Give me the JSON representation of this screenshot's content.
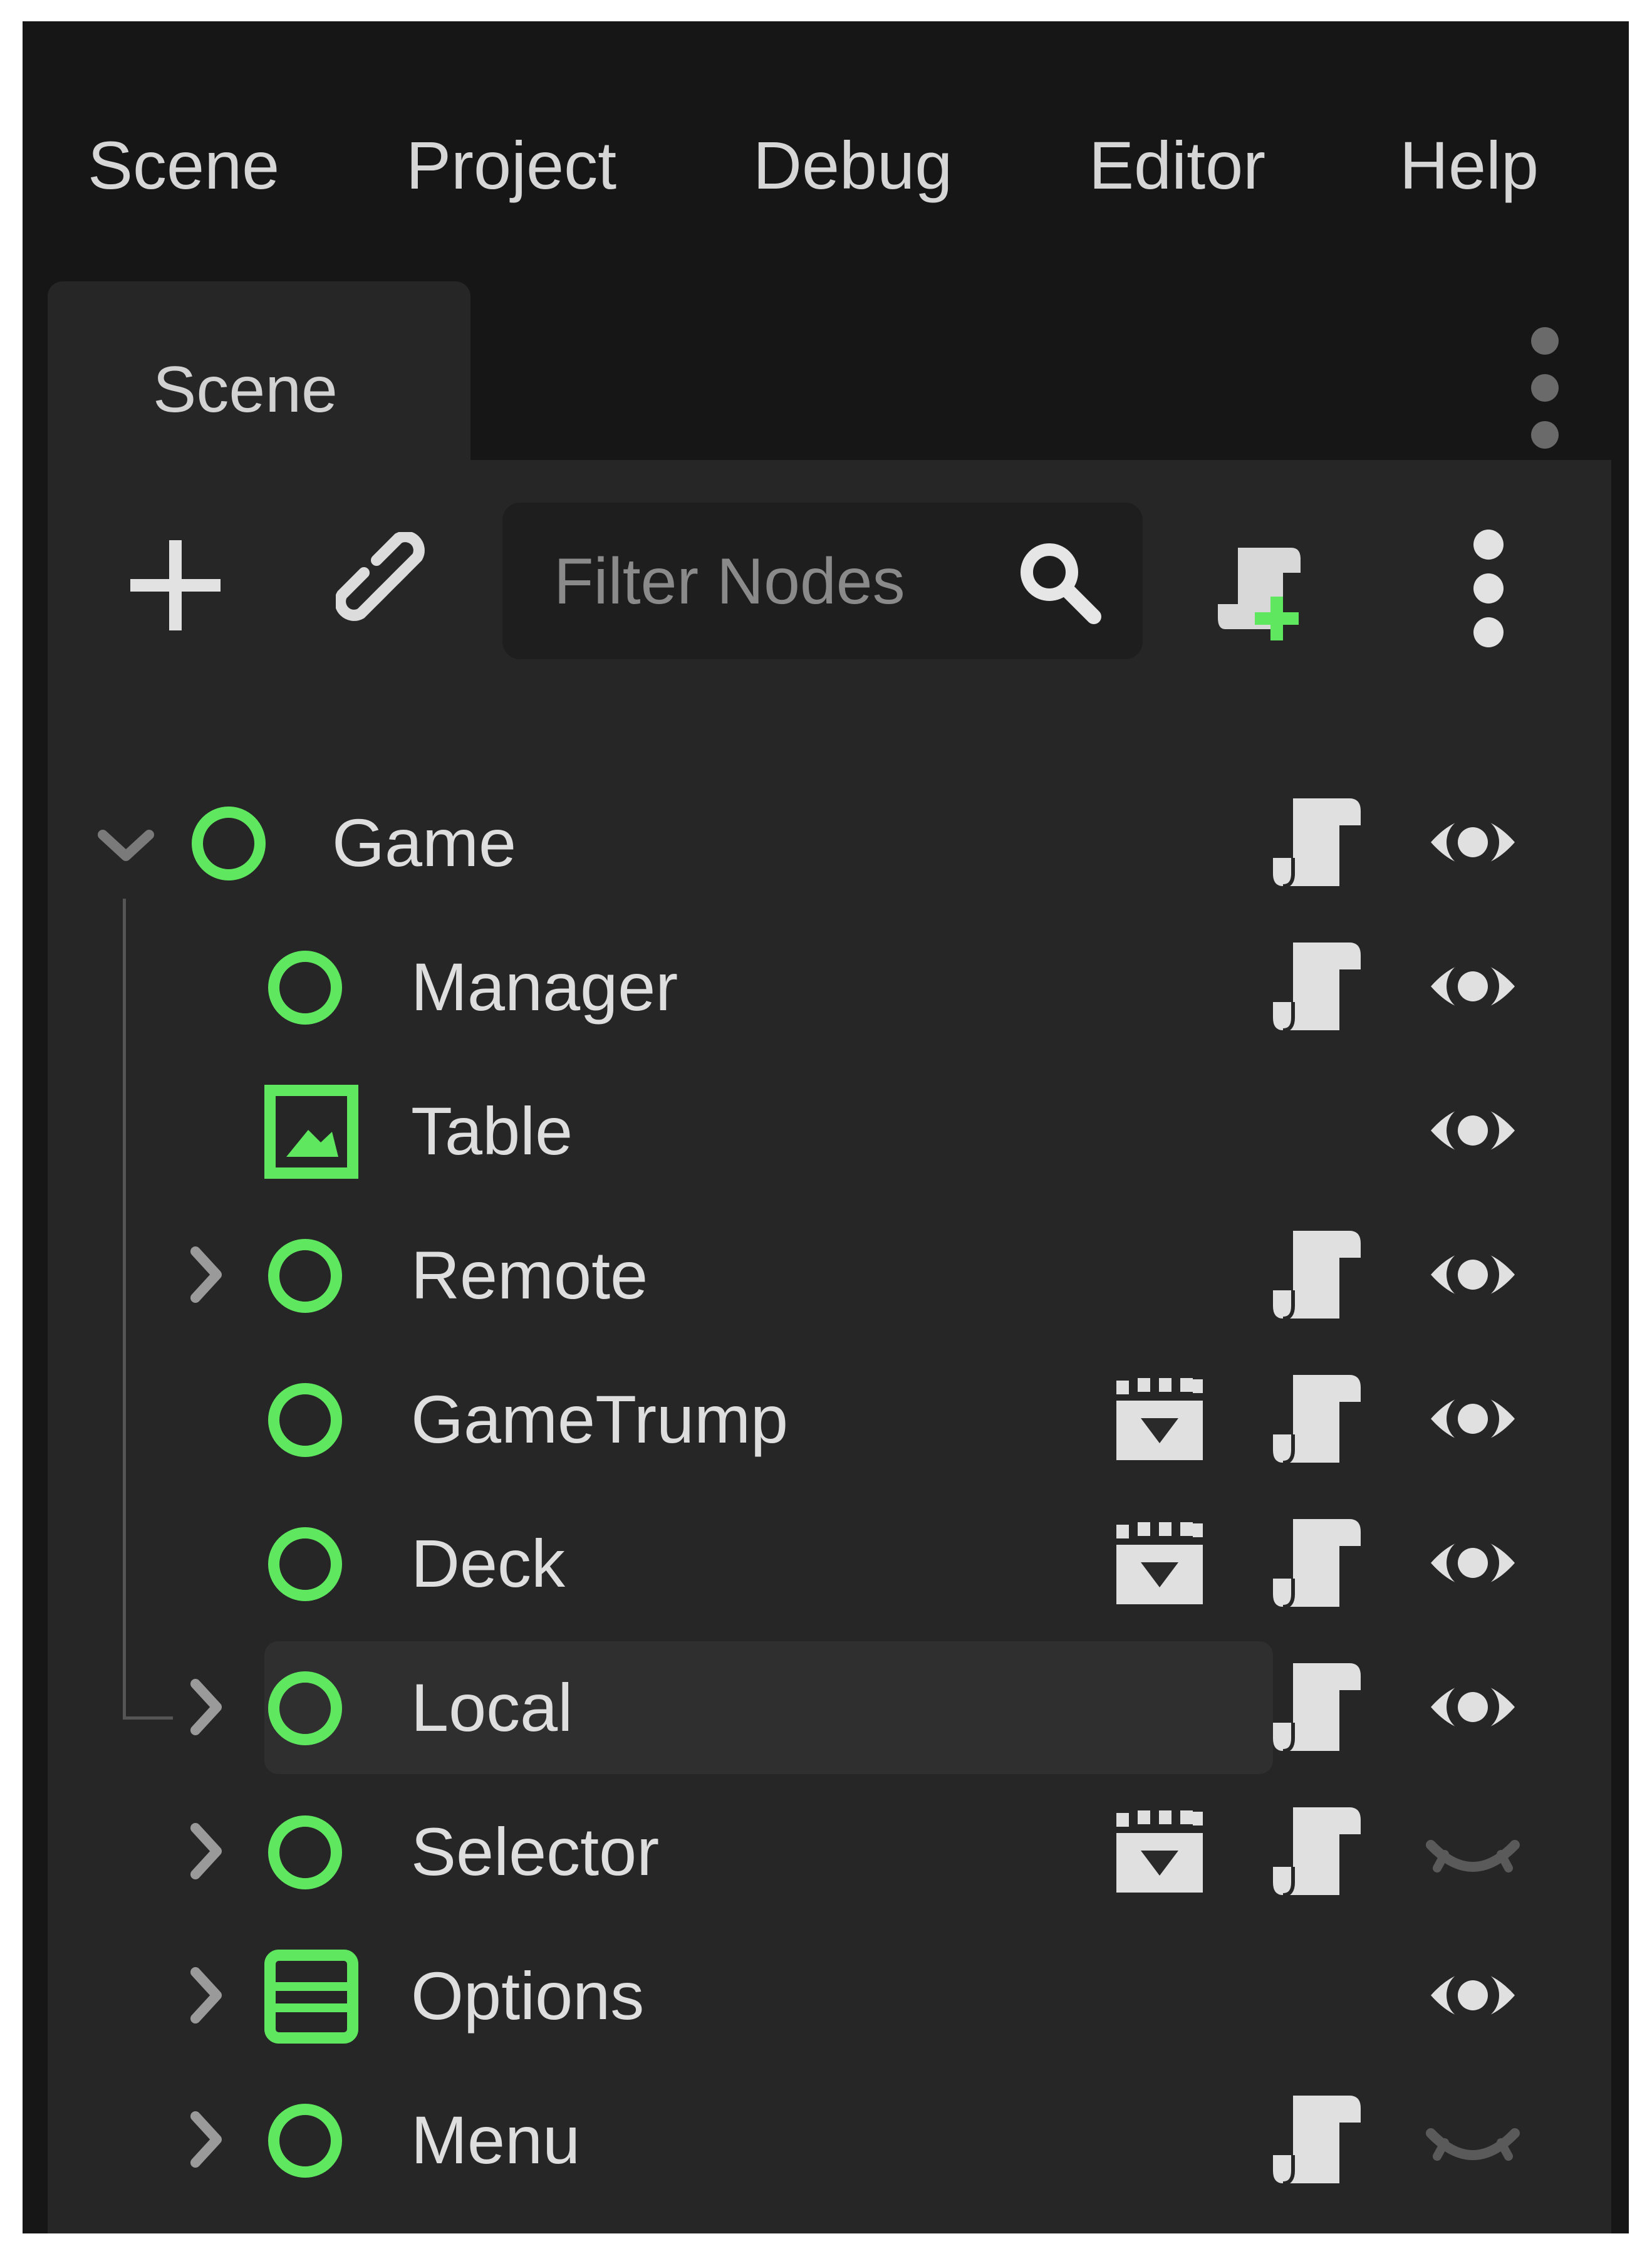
{
  "menubar": {
    "items": [
      "Scene",
      "Project",
      "Debug",
      "Editor",
      "Help"
    ]
  },
  "dock": {
    "tab_label": "Scene"
  },
  "toolbar": {
    "add_icon": "plus-icon",
    "instance_icon": "link-icon",
    "filter_placeholder": "Filter Nodes",
    "filter_icon": "search-icon",
    "attach_script_icon": "script-add-icon",
    "more_icon": "vertical-dots-icon"
  },
  "tree": {
    "nodes": [
      {
        "name": "Game",
        "depth": 0,
        "type_icon": "node-circle-icon",
        "arrow": "expanded",
        "scene_icon": false,
        "script_icon": true,
        "visible": true
      },
      {
        "name": "Manager",
        "depth": 1,
        "type_icon": "node-circle-icon",
        "arrow": "none",
        "scene_icon": false,
        "script_icon": true,
        "visible": true
      },
      {
        "name": "Table",
        "depth": 1,
        "type_icon": "texture-rect-icon",
        "arrow": "none",
        "scene_icon": false,
        "script_icon": false,
        "visible": true
      },
      {
        "name": "Remote",
        "depth": 1,
        "type_icon": "node-circle-icon",
        "arrow": "collapsed",
        "scene_icon": false,
        "script_icon": true,
        "visible": true
      },
      {
        "name": "GameTrump",
        "depth": 1,
        "type_icon": "node-circle-icon",
        "arrow": "none",
        "scene_icon": true,
        "script_icon": true,
        "visible": true
      },
      {
        "name": "Deck",
        "depth": 1,
        "type_icon": "node-circle-icon",
        "arrow": "none",
        "scene_icon": true,
        "script_icon": true,
        "visible": true
      },
      {
        "name": "Local",
        "depth": 1,
        "type_icon": "node-circle-icon",
        "arrow": "collapsed",
        "scene_icon": false,
        "script_icon": true,
        "visible": true,
        "selected": true
      },
      {
        "name": "Selector",
        "depth": 1,
        "type_icon": "node-circle-icon",
        "arrow": "collapsed",
        "scene_icon": true,
        "script_icon": true,
        "visible": false
      },
      {
        "name": "Options",
        "depth": 1,
        "type_icon": "vbox-container-icon",
        "arrow": "collapsed",
        "scene_icon": false,
        "script_icon": false,
        "visible": true
      },
      {
        "name": "Menu",
        "depth": 1,
        "type_icon": "node-circle-icon",
        "arrow": "collapsed",
        "scene_icon": false,
        "script_icon": true,
        "visible": false
      }
    ]
  },
  "colors": {
    "accent_green": "#5fe85f",
    "icon_light": "#e0e0e0",
    "arrow_gray": "#9a9a9a",
    "hidden_eye": "#5a5a5a"
  }
}
